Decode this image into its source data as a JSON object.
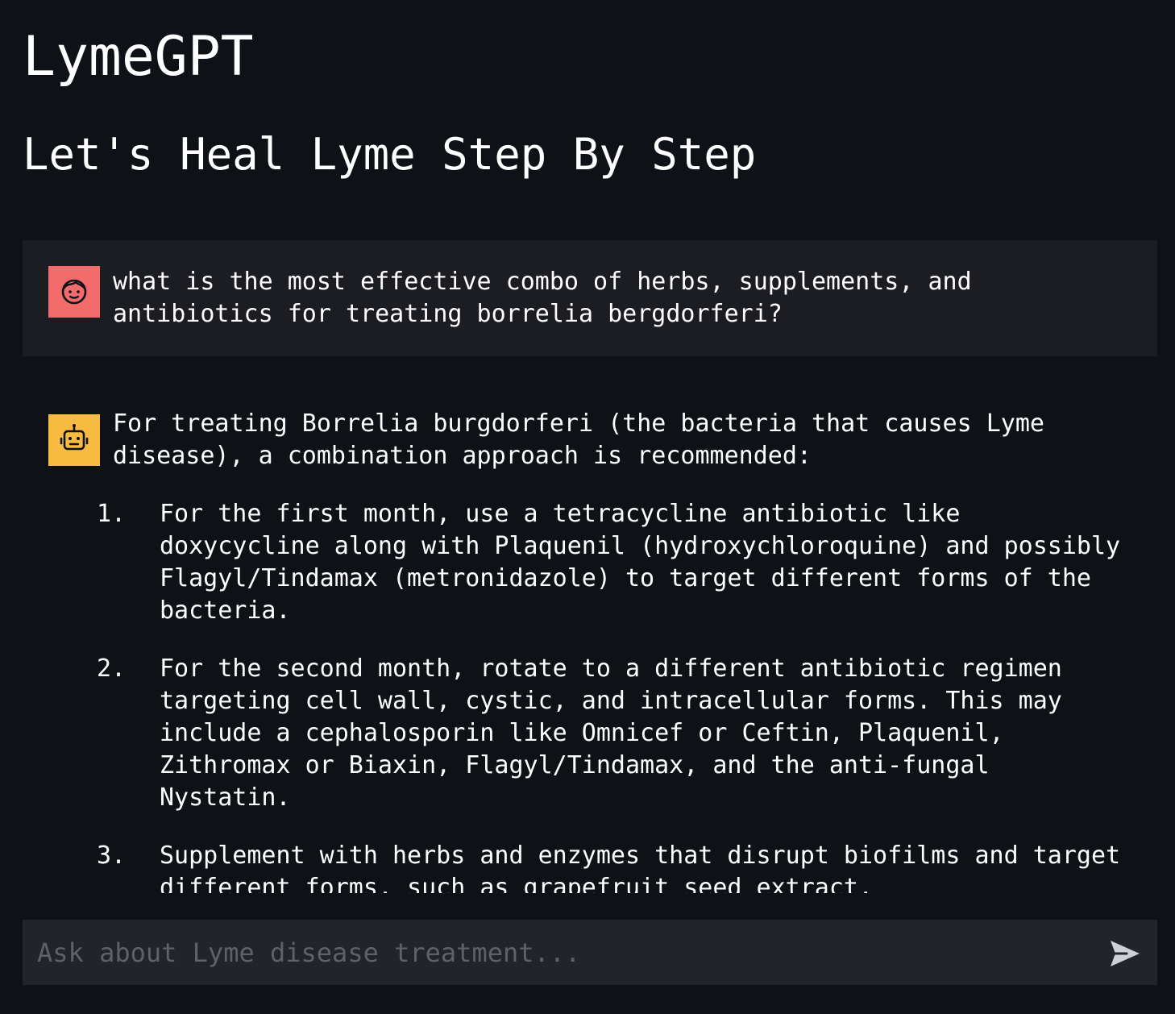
{
  "header": {
    "title": "LymeGPT",
    "subtitle": "Let's Heal Lyme Step By Step"
  },
  "colors": {
    "background": "#0e1116",
    "user_bubble": "#1c1d22",
    "user_avatar": "#f26c6c",
    "assistant_avatar": "#f8bb42",
    "input_background": "#23242b",
    "placeholder": "#5f6068",
    "send_icon": "#cfd0d6"
  },
  "messages": {
    "user": {
      "avatar_icon": "face-icon",
      "text": "what is the most effective combo of herbs, supplements, and antibiotics for treating borrelia bergdorferi?"
    },
    "assistant": {
      "avatar_icon": "robot-icon",
      "intro": "For treating Borrelia burgdorferi (the bacteria that causes Lyme disease), a combination approach is recommended:",
      "steps": [
        {
          "number": "1.",
          "text": "For the first month, use a tetracycline antibiotic like doxycycline along with Plaquenil (hydroxychloroquine) and possibly Flagyl/Tindamax (metronidazole) to target different forms of the bacteria."
        },
        {
          "number": "2.",
          "text": "For the second month, rotate to a different antibiotic regimen targeting cell wall, cystic, and intracellular forms. This may include a cephalosporin like Omnicef or Ceftin, Plaquenil, Zithromax or Biaxin, Flagyl/Tindamax, and the anti-fungal Nystatin."
        },
        {
          "number": "3.",
          "text": "Supplement with herbs and enzymes that disrupt biofilms and target different forms, such as grapefruit seed extract,"
        }
      ]
    }
  },
  "input": {
    "placeholder": "Ask about Lyme disease treatment...",
    "value": "",
    "send_icon": "send-icon"
  }
}
